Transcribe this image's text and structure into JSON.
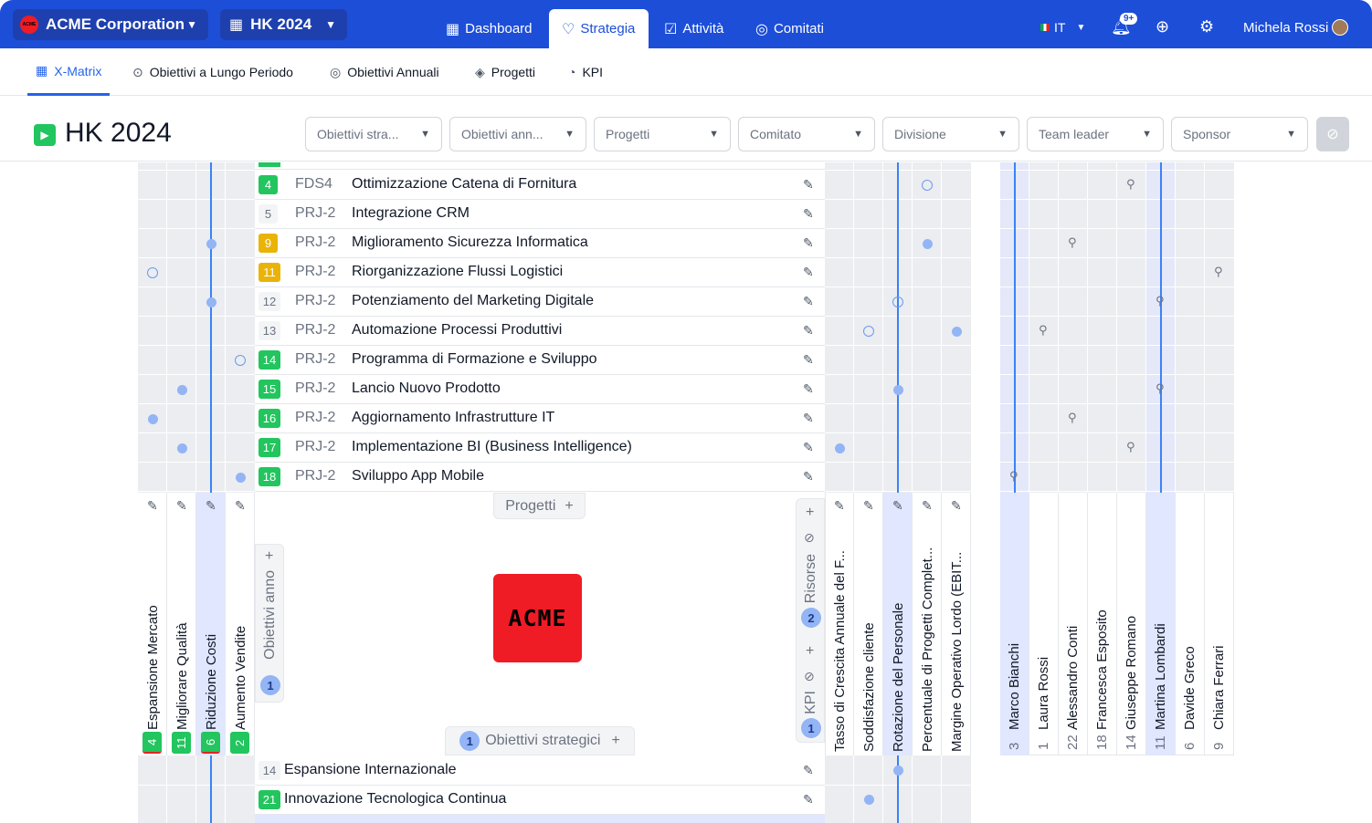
{
  "topbar": {
    "company": "ACME Corporation",
    "logo_text": "ACME",
    "plan": "HK 2024",
    "user": "Michela Rossi",
    "lang": "IT",
    "notif_count": "9+"
  },
  "nav": [
    {
      "label": "Dashboard",
      "icon": "grid-icon"
    },
    {
      "label": "Strategia",
      "icon": "bulb-icon"
    },
    {
      "label": "Attività",
      "icon": "check-icon"
    },
    {
      "label": "Comitati",
      "icon": "people-icon"
    }
  ],
  "tabs": [
    {
      "label": "X-Matrix"
    },
    {
      "label": "Obiettivi a Lungo Periodo"
    },
    {
      "label": "Obiettivi Annuali"
    },
    {
      "label": "Progetti"
    },
    {
      "label": "KPI"
    }
  ],
  "page": {
    "title": "HK 2024"
  },
  "filters": [
    {
      "label": "Obiettivi stra..."
    },
    {
      "label": "Obiettivi ann..."
    },
    {
      "label": "Progetti"
    },
    {
      "label": "Comitato"
    },
    {
      "label": "Divisione"
    },
    {
      "label": "Team leader"
    },
    {
      "label": "Sponsor"
    }
  ],
  "projects": [
    {
      "num": "4",
      "code": "FDS4",
      "title": "Ottimizzazione Catena di Fornitura",
      "color": "#22c55e"
    },
    {
      "num": "5",
      "code": "PRJ-2",
      "title": "Integrazione CRM",
      "color": ""
    },
    {
      "num": "9",
      "code": "PRJ-2",
      "title": "Miglioramento Sicurezza Informatica",
      "color": "#eab308"
    },
    {
      "num": "11",
      "code": "PRJ-2",
      "title": "Riorganizzazione Flussi Logistici",
      "color": "#eab308"
    },
    {
      "num": "12",
      "code": "PRJ-2",
      "title": "Potenziamento del Marketing Digitale",
      "color": ""
    },
    {
      "num": "13",
      "code": "PRJ-2",
      "title": "Automazione Processi Produttivi",
      "color": ""
    },
    {
      "num": "14",
      "code": "PRJ-2",
      "title": "Programma di Formazione e Sviluppo",
      "color": "#22c55e"
    },
    {
      "num": "15",
      "code": "PRJ-2",
      "title": "Lancio Nuovo Prodotto",
      "color": "#22c55e"
    },
    {
      "num": "16",
      "code": "PRJ-2",
      "title": "Aggiornamento Infrastrutture IT",
      "color": "#22c55e"
    },
    {
      "num": "17",
      "code": "PRJ-2",
      "title": "Implementazione BI (Business Intelligence)",
      "color": "#22c55e"
    },
    {
      "num": "18",
      "code": "PRJ-2",
      "title": "Sviluppo App Mobile",
      "color": "#22c55e"
    }
  ],
  "annual_objectives": [
    {
      "num": "4",
      "title": "Espansione Mercato"
    },
    {
      "num": "11",
      "title": "Migliorare Qualità"
    },
    {
      "num": "6",
      "title": "Riduzione Costi"
    },
    {
      "num": "2",
      "title": "Aumento Vendite"
    }
  ],
  "kpis": [
    {
      "title": "Tasso di Crescita Annuale del F..."
    },
    {
      "title": "Soddisfazione cliente"
    },
    {
      "title": "Rotazione del Personale"
    },
    {
      "title": "Percentuale di Progetti Complet..."
    },
    {
      "title": "Margine Operativo Lordo (EBIT..."
    }
  ],
  "people": [
    {
      "num": "3",
      "name": "Marco Bianchi"
    },
    {
      "num": "1",
      "name": "Laura Rossi"
    },
    {
      "num": "22",
      "name": "Alessandro Conti"
    },
    {
      "num": "18",
      "name": "Francesca Esposito"
    },
    {
      "num": "14",
      "name": "Giuseppe Romano"
    },
    {
      "num": "11",
      "name": "Martina Lombardi"
    },
    {
      "num": "6",
      "name": "Davide Greco"
    },
    {
      "num": "9",
      "name": "Chiara Ferrari"
    }
  ],
  "center": {
    "projects_label": "Progetti",
    "annual_label": "Obiettivi anno",
    "annual_count": "1",
    "strategic_label": "Obiettivi strategici",
    "strategic_count": "1",
    "resources_label": "Risorse",
    "resources_count": "2",
    "kpi_label": "KPI",
    "kpi_count": "1"
  },
  "strategic": [
    {
      "num": "14",
      "title": "Espansione Internazionale"
    },
    {
      "num": "21",
      "title": "Innovazione Tecnologica Continua"
    }
  ]
}
